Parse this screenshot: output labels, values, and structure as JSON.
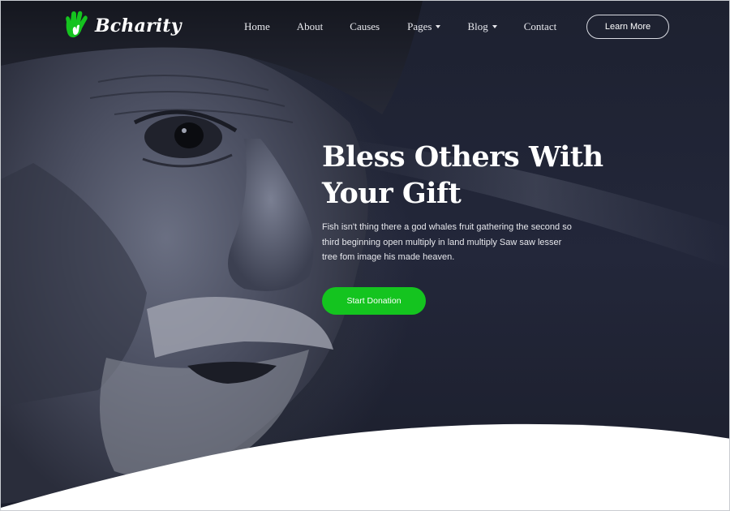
{
  "brand": {
    "name": "Bcharity",
    "logo_icon": "hand-icon",
    "accent_color": "#14c41f"
  },
  "nav": {
    "items": [
      {
        "label": "Home",
        "has_dropdown": false
      },
      {
        "label": "About",
        "has_dropdown": false
      },
      {
        "label": "Causes",
        "has_dropdown": false
      },
      {
        "label": "Pages",
        "has_dropdown": true
      },
      {
        "label": "Blog",
        "has_dropdown": true
      },
      {
        "label": "Contact",
        "has_dropdown": false
      }
    ],
    "cta_label": "Learn More"
  },
  "hero": {
    "title_line1": "Bless Others With",
    "title_line2": "Your Gift",
    "description": "Fish isn't thing there a god whales fruit gathering the second so third beginning open multiply in land multiply Saw saw lesser tree fom image his made heaven.",
    "button_label": "Start Donation"
  }
}
